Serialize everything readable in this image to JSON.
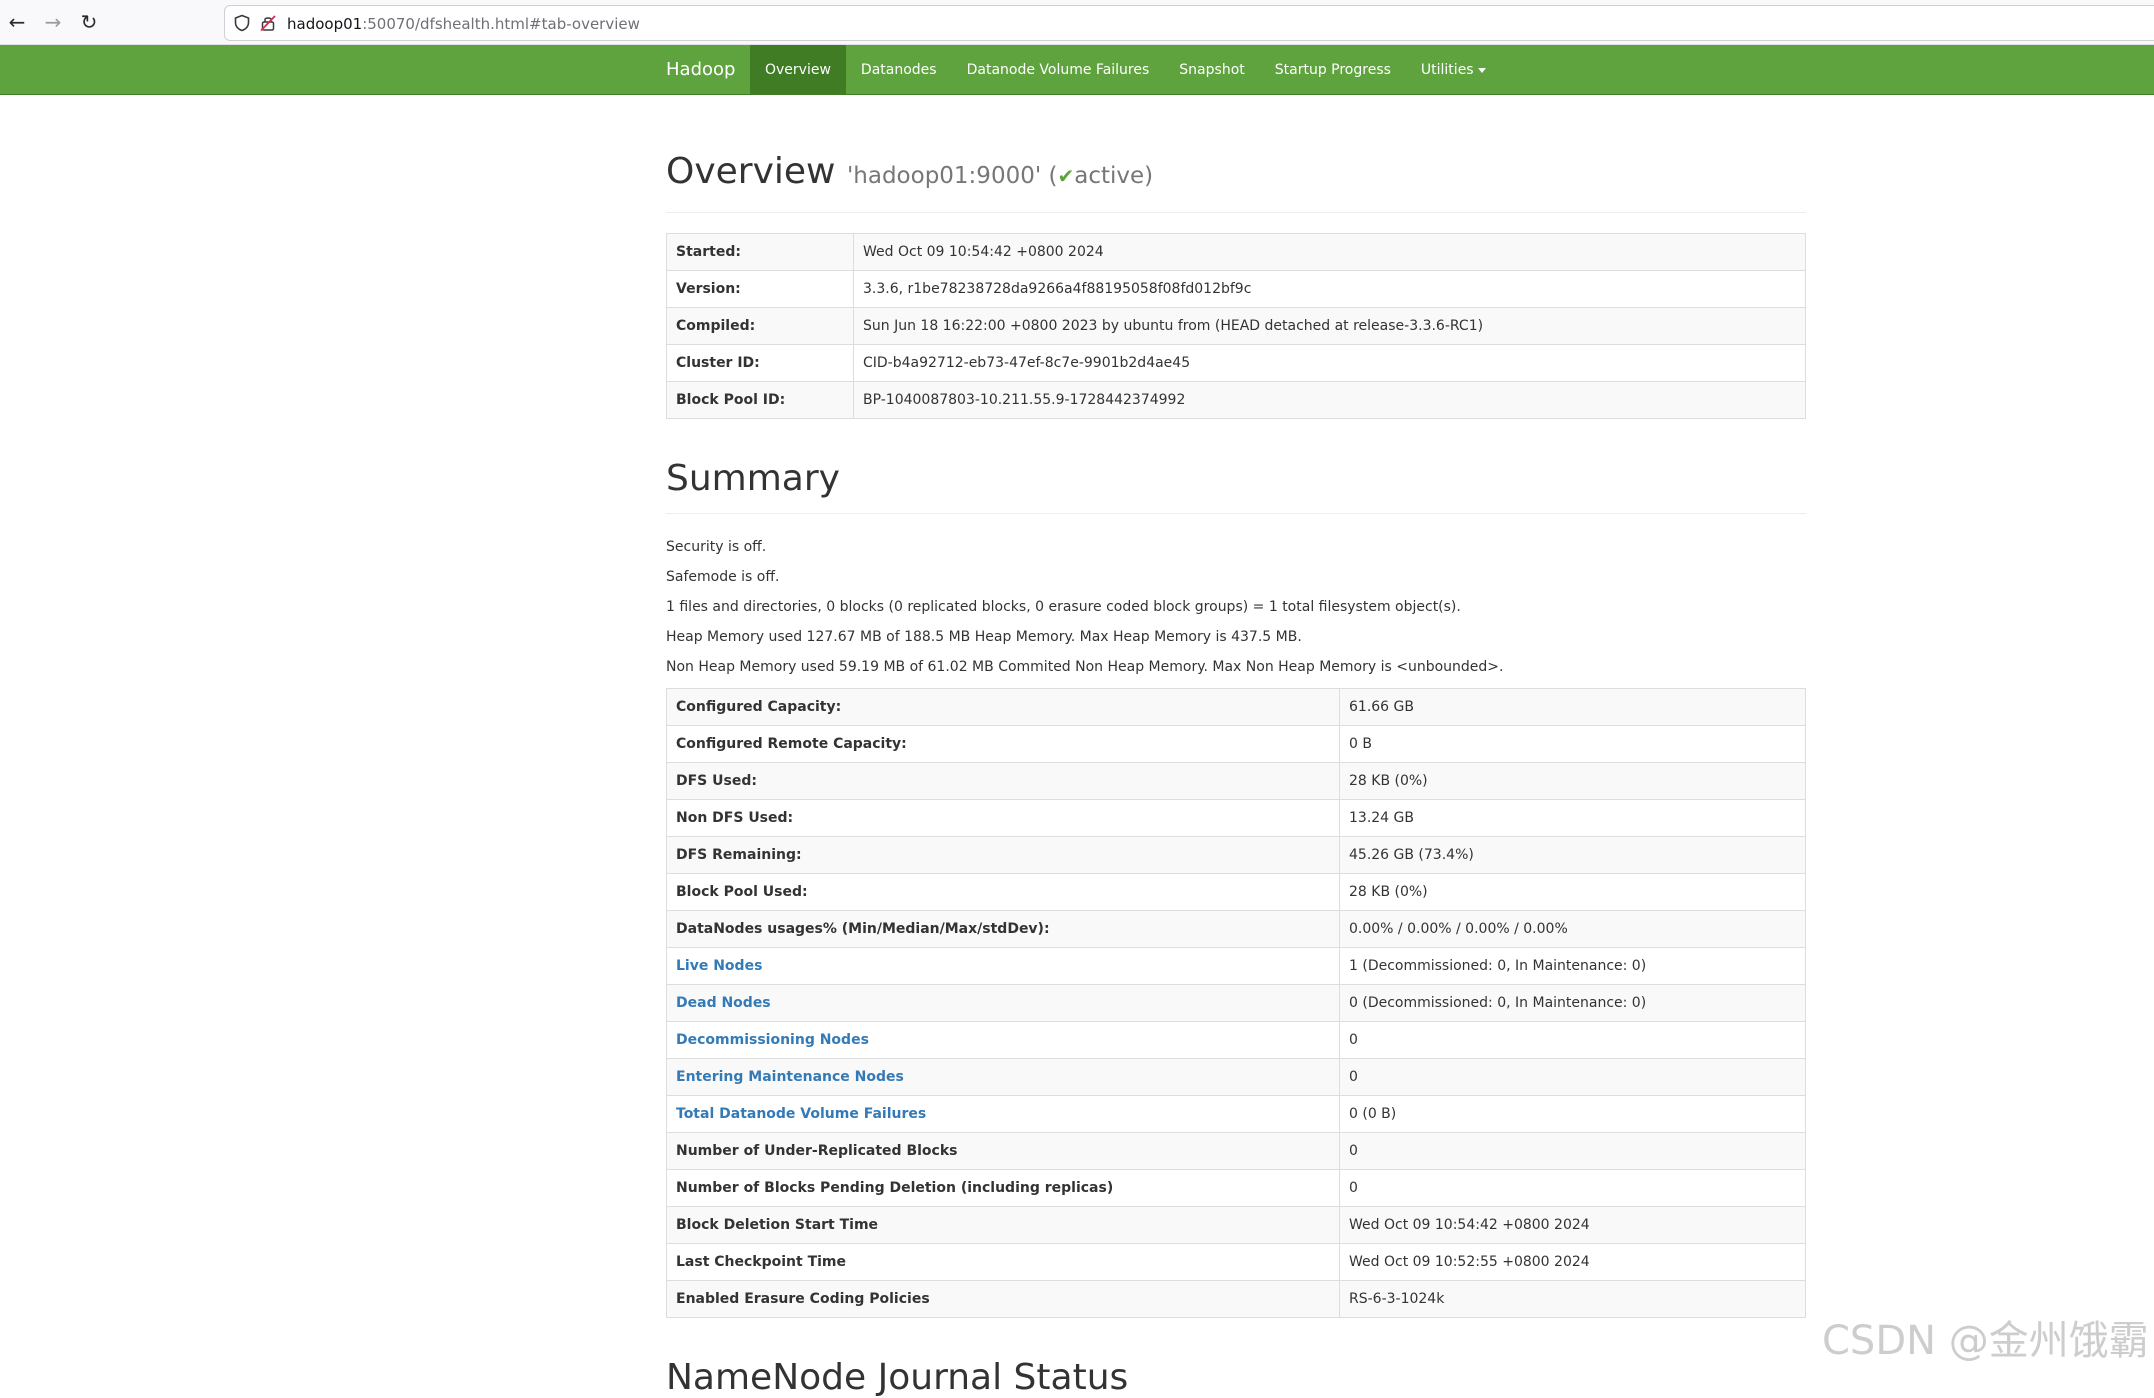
{
  "browser": {
    "back_icon": "←",
    "forward_icon": "→",
    "reload_icon": "↻",
    "url_host": "hadoop01",
    "url_rest": ":50070/dfshealth.html#tab-overview"
  },
  "navbar": {
    "brand": "Hadoop",
    "items": [
      {
        "label": "Overview",
        "active": true
      },
      {
        "label": "Datanodes"
      },
      {
        "label": "Datanode Volume Failures"
      },
      {
        "label": "Snapshot"
      },
      {
        "label": "Startup Progress"
      },
      {
        "label": "Utilities"
      }
    ]
  },
  "overview": {
    "title": "Overview",
    "host": "'hadoop01:9000'",
    "open_paren": "(",
    "check": "✔",
    "state": "active)",
    "rows": [
      {
        "key": "Started:",
        "value": "Wed Oct 09 10:54:42 +0800 2024"
      },
      {
        "key": "Version:",
        "value": "3.3.6, r1be78238728da9266a4f88195058f08fd012bf9c"
      },
      {
        "key": "Compiled:",
        "value": "Sun Jun 18 16:22:00 +0800 2023 by ubuntu from (HEAD detached at release-3.3.6-RC1)"
      },
      {
        "key": "Cluster ID:",
        "value": "CID-b4a92712-eb73-47ef-8c7e-9901b2d4ae45"
      },
      {
        "key": "Block Pool ID:",
        "value": "BP-1040087803-10.211.55.9-1728442374992"
      }
    ]
  },
  "summary": {
    "title": "Summary",
    "lines": [
      "Security is off.",
      "Safemode is off.",
      "1 files and directories, 0 blocks (0 replicated blocks, 0 erasure coded block groups) = 1 total filesystem object(s).",
      "Heap Memory used 127.67 MB of 188.5 MB Heap Memory. Max Heap Memory is 437.5 MB.",
      "Non Heap Memory used 59.19 MB of 61.02 MB Commited Non Heap Memory. Max Non Heap Memory is <unbounded>."
    ],
    "rows": [
      {
        "key": "Configured Capacity:",
        "value": "61.66 GB"
      },
      {
        "key": "Configured Remote Capacity:",
        "value": "0 B"
      },
      {
        "key": "DFS Used:",
        "value": "28 KB (0%)"
      },
      {
        "key": "Non DFS Used:",
        "value": "13.24 GB"
      },
      {
        "key": "DFS Remaining:",
        "value": "45.26 GB (73.4%)"
      },
      {
        "key": "Block Pool Used:",
        "value": "28 KB (0%)"
      },
      {
        "key": "DataNodes usages% (Min/Median/Max/stdDev):",
        "value": "0.00% / 0.00% / 0.00% / 0.00%"
      },
      {
        "key": "Live Nodes",
        "value": "1 (Decommissioned: 0, In Maintenance: 0)",
        "link": true
      },
      {
        "key": "Dead Nodes",
        "value": "0 (Decommissioned: 0, In Maintenance: 0)",
        "link": true
      },
      {
        "key": "Decommissioning Nodes",
        "value": "0",
        "link": true
      },
      {
        "key": "Entering Maintenance Nodes",
        "value": "0",
        "link": true
      },
      {
        "key": "Total Datanode Volume Failures",
        "value": "0 (0 B)",
        "link": true
      },
      {
        "key": "Number of Under-Replicated Blocks",
        "value": "0"
      },
      {
        "key": "Number of Blocks Pending Deletion (including replicas)",
        "value": "0"
      },
      {
        "key": "Block Deletion Start Time",
        "value": "Wed Oct 09 10:54:42 +0800 2024"
      },
      {
        "key": "Last Checkpoint Time",
        "value": "Wed Oct 09 10:52:55 +0800 2024"
      },
      {
        "key": "Enabled Erasure Coding Policies",
        "value": "RS-6-3-1024k"
      }
    ]
  },
  "next_section": {
    "title": "NameNode Journal Status"
  },
  "watermark": "CSDN @金州饿霸",
  "colors": {
    "navbar": "#5fa33e",
    "navbar_active": "#3f7c24",
    "link": "#337ab7"
  }
}
